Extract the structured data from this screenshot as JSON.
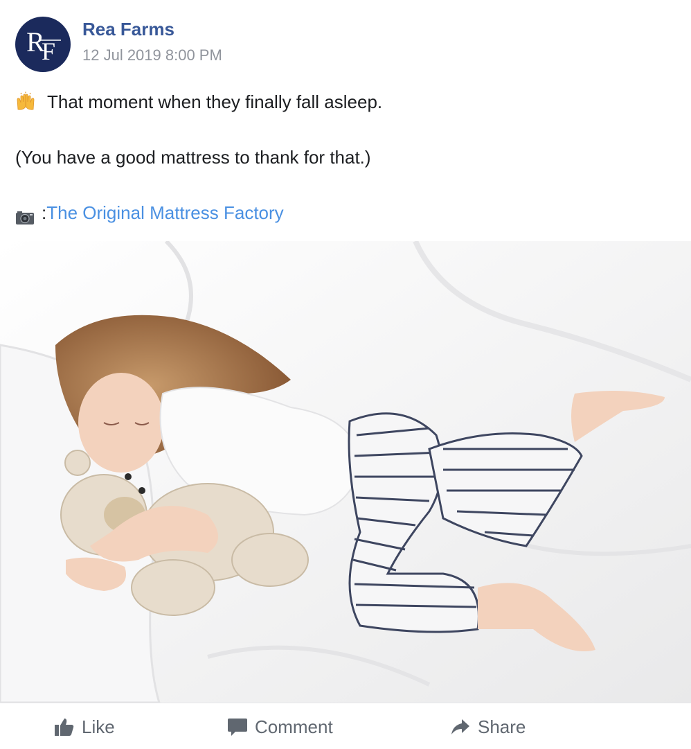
{
  "post": {
    "author": {
      "name": "Rea Farms",
      "avatar_initials": "RF"
    },
    "timestamp": "12 Jul 2019 8:00 PM",
    "text": {
      "line1_emoji": "raising-hands-icon",
      "line1": "That moment when they finally fall asleep.",
      "line2": "(You have a good mattress to thank for that.)",
      "line3_emoji": "camera-icon",
      "line3_prefix": ": ",
      "credit_link": "The Original Mattress Factory"
    },
    "image": {
      "description_icon": "photo-sleeping-child"
    },
    "actions": [
      {
        "label": "Like",
        "icon": "thumbs-up-icon"
      },
      {
        "label": "Comment",
        "icon": "comment-icon"
      },
      {
        "label": "Share",
        "icon": "share-arrow-icon"
      }
    ]
  },
  "colors": {
    "avatar_bg": "#1b2a5c",
    "author": "#385898",
    "timestamp": "#90949c",
    "link": "#4a90e2",
    "action_text": "#606770"
  }
}
